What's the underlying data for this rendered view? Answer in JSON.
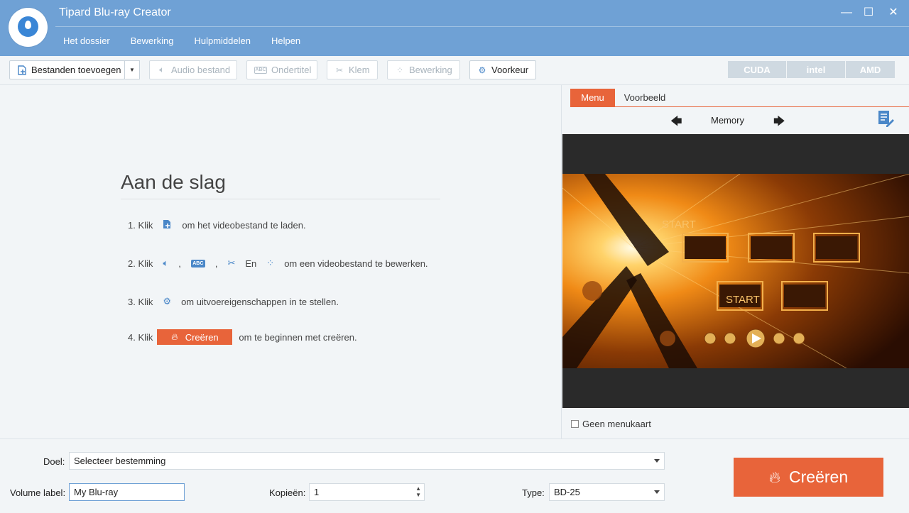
{
  "window": {
    "title": "Tipard Blu-ray Creator",
    "controls": {
      "minimize": "—",
      "maximize": "☐",
      "close": "✕"
    }
  },
  "menu": {
    "items": [
      {
        "label": "Het dossier"
      },
      {
        "label": "Bewerking"
      },
      {
        "label": "Hulpmiddelen"
      },
      {
        "label": "Helpen"
      }
    ]
  },
  "toolbar": {
    "add_files": "Bestanden toevoegen",
    "audio": "Audio bestand",
    "subtitle": "Ondertitel",
    "clip": "Klem",
    "edit": "Bewerking",
    "preferences": "Voorkeur",
    "hw": {
      "cuda": "CUDA",
      "intel": "intel",
      "amd": "AMD"
    }
  },
  "getting_started": {
    "title": "Aan de slag",
    "step1": {
      "prefix": "1. Klik",
      "suffix": "om het videobestand te laden."
    },
    "step2": {
      "prefix": "2. Klik",
      "sep1": ",",
      "sep2": ",",
      "and": "En",
      "suffix": "om een videobestand te bewerken."
    },
    "step3": {
      "prefix": "3. Klik",
      "suffix": "om uitvoereigenschappen in te stellen."
    },
    "step4": {
      "prefix": "4. Klik",
      "button": "Creëren",
      "suffix": "om te beginnen met creëren."
    }
  },
  "preview": {
    "tabs": [
      {
        "label": "Menu"
      },
      {
        "label": "Voorbeeld"
      }
    ],
    "template_name": "Memory",
    "start_label": "START",
    "no_menu_label": "Geen menukaart",
    "no_menu_checked": false
  },
  "bottom": {
    "target_label": "Doel:",
    "target_value": "Selecteer bestemming",
    "volume_label": "Volume label:",
    "volume_value": "My Blu-ray",
    "copies_label": "Kopieën:",
    "copies_value": "1",
    "type_label": "Type:",
    "type_value": "BD-25",
    "create_button": "Creëren"
  },
  "colors": {
    "titlebar": "#6fa1d5",
    "accent": "#e8643a",
    "icon_blue": "#4a87c8"
  }
}
